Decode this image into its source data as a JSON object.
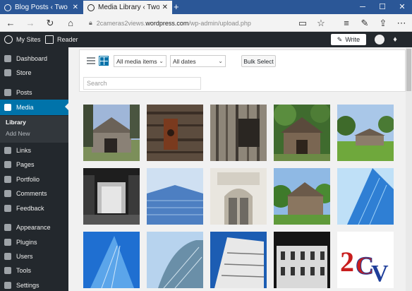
{
  "browser": {
    "tabs": [
      {
        "label": "Blog Posts ‹ Two Cameras",
        "active": false
      },
      {
        "label": "Media Library ‹ Two Car",
        "active": true
      }
    ],
    "new_tab": "+",
    "url_subdomain": "2cameras2views.",
    "url_domain": "wordpress.com",
    "url_path": "/wp-admin/upload.php"
  },
  "adminbar": {
    "my_sites": "My Sites",
    "reader": "Reader",
    "write": "Write"
  },
  "sidebar": {
    "items": [
      {
        "label": "Dashboard",
        "icon": "dashboard-icon"
      },
      {
        "label": "Store",
        "icon": "store-icon"
      },
      {
        "label": "Posts",
        "icon": "pin-icon"
      },
      {
        "label": "Media",
        "icon": "media-icon"
      },
      {
        "label": "Links",
        "icon": "links-icon"
      },
      {
        "label": "Pages",
        "icon": "pages-icon"
      },
      {
        "label": "Portfolio",
        "icon": "portfolio-icon"
      },
      {
        "label": "Comments",
        "icon": "comments-icon"
      },
      {
        "label": "Feedback",
        "icon": "feedback-icon"
      },
      {
        "label": "Appearance",
        "icon": "appearance-icon"
      },
      {
        "label": "Plugins",
        "icon": "plugins-icon"
      },
      {
        "label": "Users",
        "icon": "users-icon"
      },
      {
        "label": "Tools",
        "icon": "tools-icon"
      },
      {
        "label": "Settings",
        "icon": "settings-icon"
      }
    ],
    "submenu": [
      "Library",
      "Add New"
    ]
  },
  "toolbar": {
    "filter_type": "All media items",
    "filter_date": "All dates",
    "bulk_select": "Bulk Select",
    "search_placeholder": "Search"
  },
  "media": [
    {
      "subject": "gray wooden barn with trees"
    },
    {
      "subject": "rusty hinge on weathered wood"
    },
    {
      "subject": "weathered wooden barn wall"
    },
    {
      "subject": "wooden barn with green trees"
    },
    {
      "subject": "barn in green field"
    },
    {
      "subject": "barn interior black and white"
    },
    {
      "subject": "curved glass skyscraper"
    },
    {
      "subject": "white building entrance with doors"
    },
    {
      "subject": "old barn with trees"
    },
    {
      "subject": "blue glass skyscraper"
    },
    {
      "subject": "blue glass tower looking up"
    },
    {
      "subject": "curved tower against sky"
    },
    {
      "subject": "office tower facade"
    },
    {
      "subject": "historic building facade"
    },
    {
      "subject": "2CV logo"
    }
  ],
  "colors": {
    "tabbar": "#2b5797",
    "adminbar": "#23282d",
    "accent": "#0073aa"
  }
}
